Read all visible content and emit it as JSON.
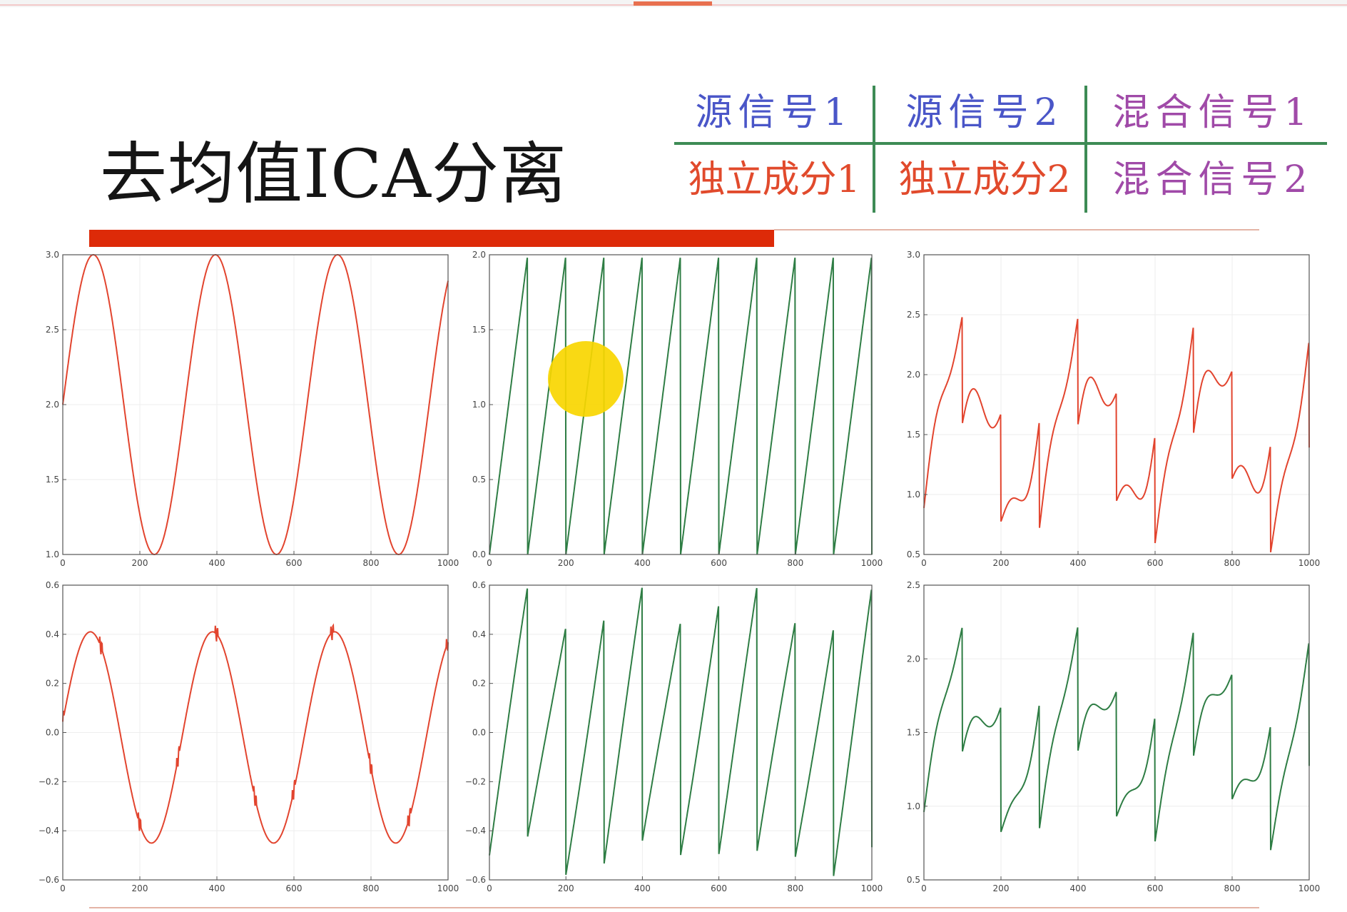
{
  "slide": {
    "title": "去均值ICA分离"
  },
  "legend": {
    "source1": "源信号1",
    "source2": "源信号2",
    "mixed1": "混合信号1",
    "ica1": "独立成分1",
    "ica2": "独立成分2",
    "mixed2": "混合信号2"
  },
  "colors": {
    "red_line": "#e2442e",
    "green_line": "#2e7d44",
    "title_bar": "#dd2a08",
    "highlight": "#f8d600"
  },
  "chart_data": [
    {
      "type": "line",
      "name": "source-signal-1",
      "color": "red",
      "x": [
        0,
        100,
        200,
        300,
        400,
        500,
        600,
        700,
        800,
        900,
        1000
      ],
      "formula": "2 + sin(2*pi*t/317)",
      "xlim": [
        0,
        1000
      ],
      "ylim": [
        1.0,
        3.0
      ],
      "xticks": [
        "0",
        "200",
        "400",
        "600",
        "800",
        "1000"
      ],
      "yticks": [
        "3.0",
        "2.5",
        "2.0",
        "1.5",
        "1.0"
      ]
    },
    {
      "type": "line",
      "name": "source-signal-2",
      "color": "green",
      "description_values": "sawtooth rising 0 to 2 every 100 samples",
      "xlim": [
        0,
        1000
      ],
      "ylim": [
        0.0,
        2.0
      ],
      "xticks": [
        "0",
        "200",
        "400",
        "600",
        "800",
        "1000"
      ],
      "yticks": [
        "2.0",
        "1.5",
        "1.0",
        "0.5",
        "0.0"
      ]
    },
    {
      "type": "line",
      "name": "mixed-signal-1",
      "color": "red",
      "xlim": [
        0,
        1000
      ],
      "ylim": [
        0.5,
        3.0
      ],
      "xticks": [
        "0",
        "200",
        "400",
        "600",
        "800",
        "1000"
      ],
      "yticks": [
        "3.0",
        "2.5",
        "2.0",
        "1.5",
        "1.0",
        "0.5"
      ]
    },
    {
      "type": "line",
      "name": "ica-component-1",
      "color": "red",
      "xlim": [
        0,
        1000
      ],
      "ylim": [
        -0.6,
        0.6
      ],
      "xticks": [
        "0",
        "200",
        "400",
        "600",
        "800",
        "1000"
      ],
      "yticks": [
        "0.6",
        "0.4",
        "0.2",
        "0.0",
        "−0.2",
        "−0.4",
        "−0.6"
      ]
    },
    {
      "type": "line",
      "name": "ica-component-2",
      "color": "green",
      "xlim": [
        0,
        1000
      ],
      "ylim": [
        -0.6,
        0.6
      ],
      "xticks": [
        "0",
        "200",
        "400",
        "600",
        "800",
        "1000"
      ],
      "yticks": [
        "0.6",
        "0.4",
        "0.2",
        "0.0",
        "−0.2",
        "−0.4",
        "−0.6"
      ]
    },
    {
      "type": "line",
      "name": "mixed-signal-2",
      "color": "green",
      "xlim": [
        0,
        1000
      ],
      "ylim": [
        0.5,
        2.5
      ],
      "xticks": [
        "0",
        "200",
        "400",
        "600",
        "800",
        "1000"
      ],
      "yticks": [
        "2.5",
        "2.0",
        "1.5",
        "1.0",
        "0.5"
      ]
    }
  ]
}
